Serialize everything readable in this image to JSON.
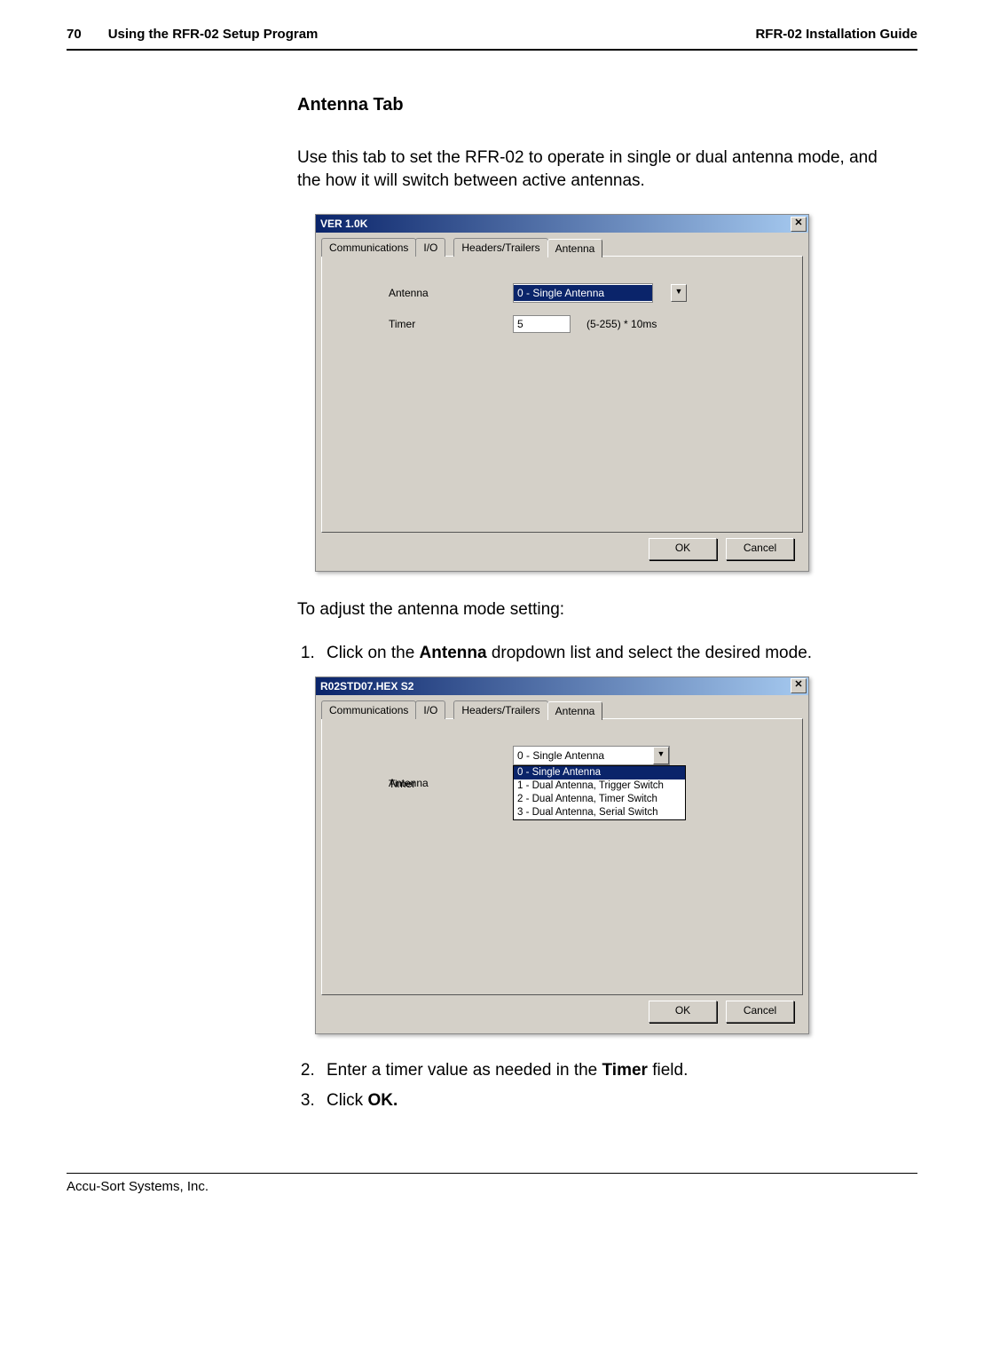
{
  "header": {
    "page_number": "70",
    "left_title": "Using the RFR-02 Setup Program",
    "right_title": "RFR-02 Installation Guide"
  },
  "section": {
    "title": "Antenna Tab",
    "intro": "Use this tab to set the RFR-02 to operate in single or dual antenna mode, and the how it will switch between active antennas."
  },
  "dialog1": {
    "title": "VER 1.0K",
    "tabs": {
      "communications": "Communications",
      "io": "I/O",
      "headers_trailers": "Headers/Trailers",
      "antenna": "Antenna"
    },
    "fields": {
      "antenna_label": "Antenna",
      "antenna_value": "0 - Single Antenna",
      "timer_label": "Timer",
      "timer_value": "5",
      "timer_hint": "(5-255) * 10ms"
    },
    "buttons": {
      "ok": "OK",
      "cancel": "Cancel"
    }
  },
  "instructions": {
    "lead": "To adjust the antenna mode setting:",
    "step1_prefix": "Click on the ",
    "step1_bold": "Antenna",
    "step1_suffix": " dropdown list and select the desired mode.",
    "step2_prefix": "Enter a timer value as needed in the ",
    "step2_bold": "Timer",
    "step2_suffix": " field.",
    "step3_prefix": "Click ",
    "step3_bold": "OK."
  },
  "dialog2": {
    "title": "R02STD07.HEX  S2",
    "tabs": {
      "communications": "Communications",
      "io": "I/O",
      "headers_trailers": "Headers/Trailers",
      "antenna": "Antenna"
    },
    "fields": {
      "antenna_label": "Antenna",
      "antenna_value": "0 - Single Antenna",
      "timer_label": "Timer"
    },
    "options": {
      "opt0": "0 - Single Antenna",
      "opt1": "1 - Dual Antenna, Trigger Switch",
      "opt2": "2 - Dual Antenna, Timer Switch",
      "opt3": "3 - Dual Antenna, Serial Switch"
    },
    "buttons": {
      "ok": "OK",
      "cancel": "Cancel"
    }
  },
  "footer": {
    "company": "Accu-Sort Systems, Inc."
  }
}
